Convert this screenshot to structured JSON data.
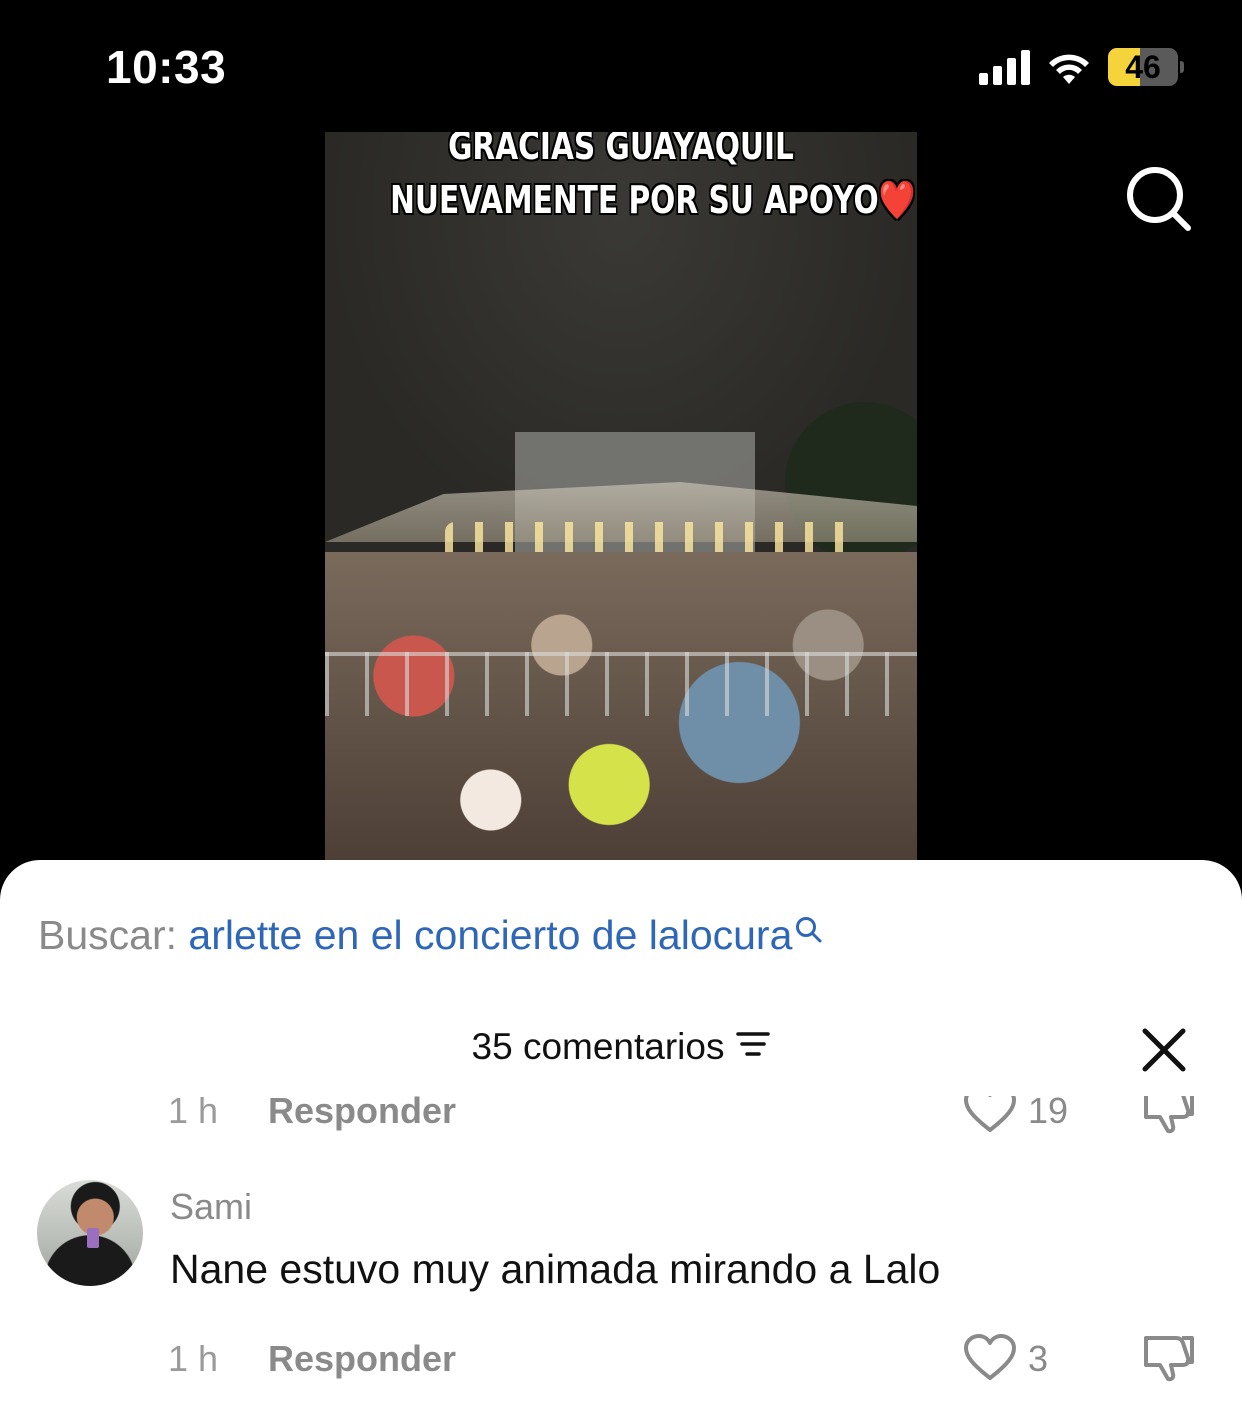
{
  "status_bar": {
    "time": "10:33",
    "battery_level": "46",
    "battery_fraction": 0.46,
    "battery_color": "#f5d33a",
    "signal_icon": "cellular-signal-icon",
    "wifi_icon": "wifi-icon"
  },
  "header": {
    "search_icon": "search-icon"
  },
  "video": {
    "caption_line1": "GRACIAS GUAYAQUIL",
    "caption_line2": "NUEVAMENTE POR SU APOYO❤️"
  },
  "sheet": {
    "search_prefix": "Buscar:",
    "search_query": "arlette en el concierto de lalocura",
    "comments_count_label": "35 comentarios",
    "accent_color": "#2f67b8"
  },
  "comments": [
    {
      "time": "1 h",
      "reply_label": "Responder",
      "likes": "19"
    },
    {
      "username": "Sami",
      "text": "Nane estuvo muy animada mirando a Lalo",
      "time": "1 h",
      "reply_label": "Responder",
      "likes": "3"
    }
  ]
}
